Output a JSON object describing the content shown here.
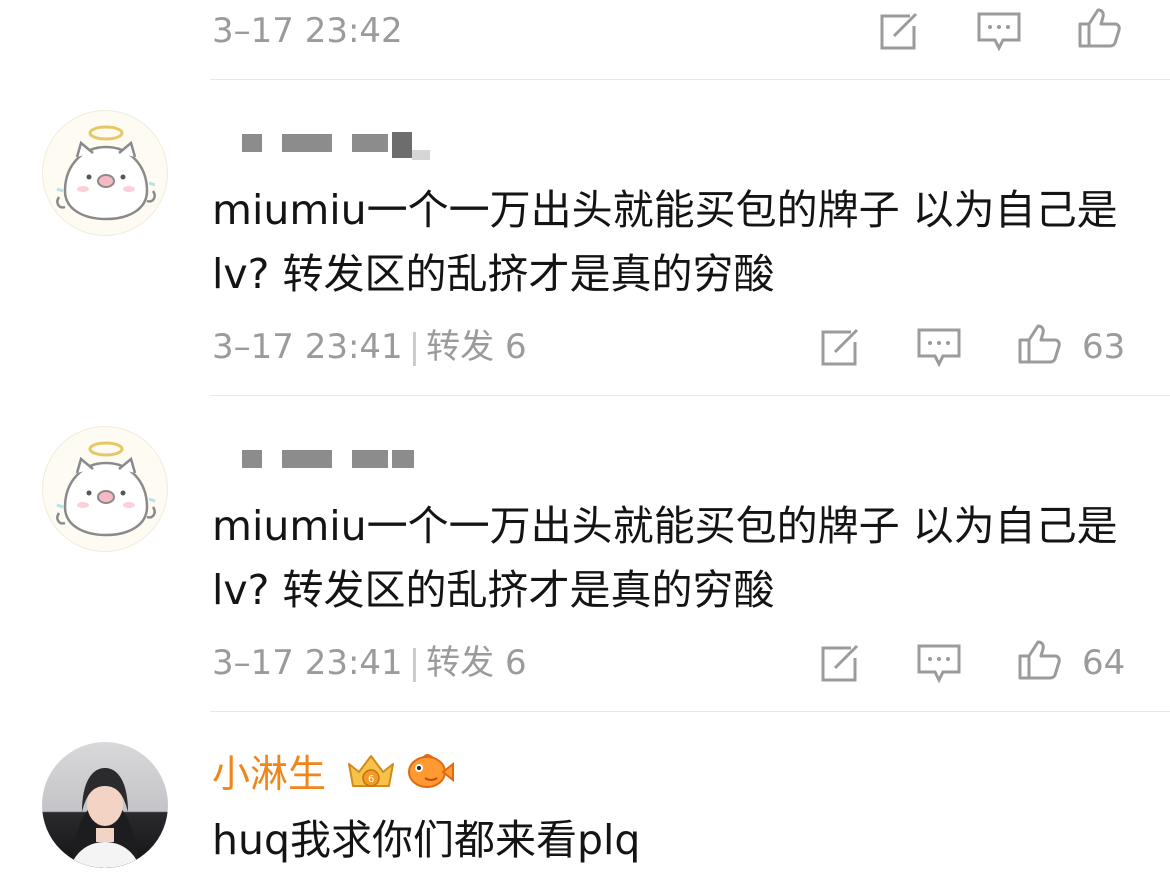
{
  "comments": [
    {
      "timestamp": "3–17 23:42",
      "actions": {
        "share_icon": "share-icon",
        "reply_icon": "comment-icon",
        "like_icon": "thumbs-up-icon"
      }
    },
    {
      "text": "miumiu一个一万出头就能买包的牌子 以为自己是lv? 转发区的乱挤才是真的穷酸",
      "timestamp": "3–17 23:41",
      "repost_label": "转发 6",
      "likes": "63"
    },
    {
      "text": "miumiu一个一万出头就能买包的牌子 以为自己是lv? 转发区的乱挤才是真的穷酸",
      "timestamp": "3–17 23:41",
      "repost_label": "转发 6",
      "likes": "64"
    },
    {
      "username": "小淋生",
      "text": "huq我求你们都来看plq"
    }
  ],
  "colors": {
    "username": "#f0861a",
    "meta": "#9b9b9b",
    "text": "#141414",
    "divider": "#e8e8e8"
  }
}
